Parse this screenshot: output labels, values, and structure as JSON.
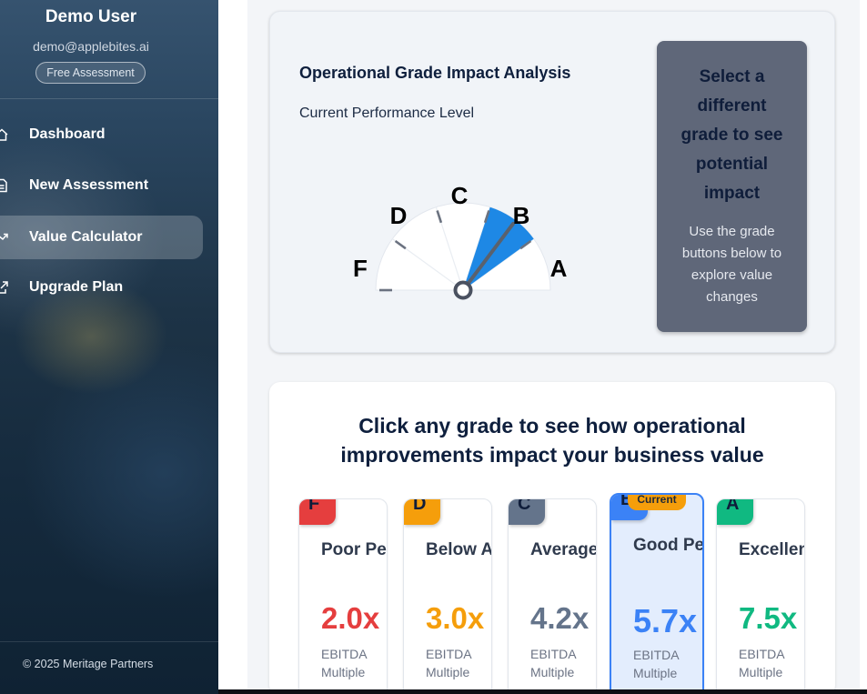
{
  "sidebar": {
    "user_name": "Demo User",
    "user_email": "demo@applebites.ai",
    "plan_badge": "Free Assessment",
    "items": [
      {
        "label": "Dashboard",
        "icon": "home-icon"
      },
      {
        "label": "New Assessment",
        "icon": "document-icon"
      },
      {
        "label": "Value Calculator",
        "icon": "trending-up-icon",
        "active": true
      },
      {
        "label": "Upgrade Plan",
        "icon": "external-link-icon"
      }
    ],
    "footer": "© 2025 Meritage Partners"
  },
  "impact": {
    "title": "Operational Grade Impact Analysis",
    "subtitle": "Current Performance Level",
    "gauge": {
      "labels": [
        "F",
        "D",
        "C",
        "B",
        "A"
      ],
      "current_grade": "B",
      "highlight_color": "#1e88e5"
    },
    "select_title": "Select a different grade to see potential impact",
    "select_body": "Use the grade buttons below to explore value changes"
  },
  "grades_section": {
    "title": "Click any grade to see how operational improvements impact your business value",
    "current_badge": "Current",
    "cards": [
      {
        "letter": "F",
        "name": "Poor Performance",
        "multiple": "2.0x",
        "ebitda_label": "EBITDA Multiple",
        "color": "#e53e3e"
      },
      {
        "letter": "D",
        "name": "Below Average",
        "multiple": "3.0x",
        "ebitda_label": "EBITDA Multiple",
        "color": "#f59e0b"
      },
      {
        "letter": "C",
        "name": "Average Performance",
        "multiple": "4.2x",
        "ebitda_label": "EBITDA Multiple",
        "color": "#64748b"
      },
      {
        "letter": "B",
        "name": "Good Performance",
        "multiple": "5.7x",
        "ebitda_label": "EBITDA Multiple",
        "color": "#3b82f6",
        "current": true
      },
      {
        "letter": "A",
        "name": "Excellent Performance",
        "multiple": "7.5x",
        "ebitda_label": "EBITDA Multiple",
        "color": "#10b981"
      }
    ]
  }
}
